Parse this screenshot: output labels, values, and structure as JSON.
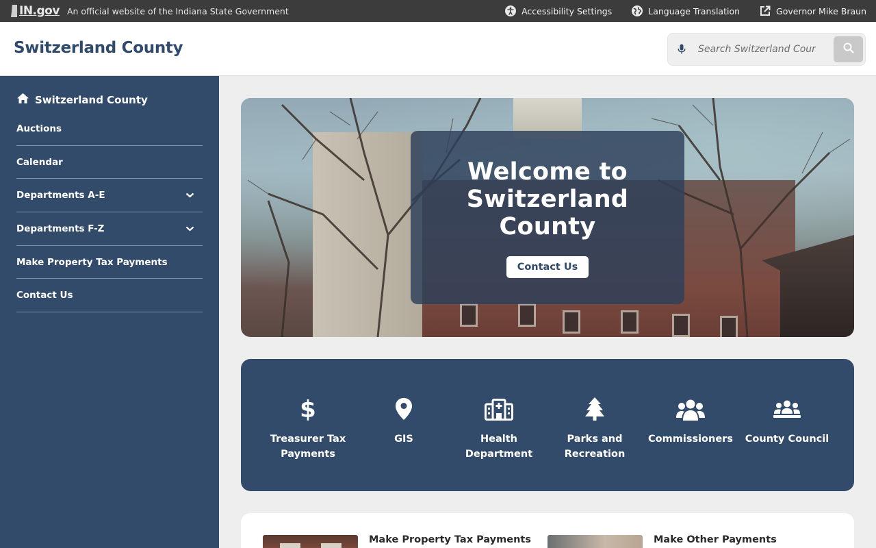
{
  "statebar": {
    "logo_text": "IN.gov",
    "official_text": "An official website of the Indiana State Government",
    "links": [
      {
        "label": "Accessibility Settings",
        "icon": "accessibility-icon"
      },
      {
        "label": "Language Translation",
        "icon": "globe-icon"
      },
      {
        "label": "Governor Mike Braun",
        "icon": "external-link-icon"
      }
    ]
  },
  "header": {
    "title": "Switzerland County",
    "search": {
      "placeholder": "Search Switzerland County",
      "value": ""
    }
  },
  "sidebar": {
    "home_label": "Switzerland County",
    "items": [
      {
        "label": "Auctions",
        "expandable": false
      },
      {
        "label": "Calendar",
        "expandable": false
      },
      {
        "label": "Departments A-E",
        "expandable": true
      },
      {
        "label": "Departments F-Z",
        "expandable": true
      },
      {
        "label": "Make Property Tax Payments",
        "expandable": false
      },
      {
        "label": "Contact Us",
        "expandable": false
      }
    ]
  },
  "hero": {
    "title": "Welcome to Switzerland County",
    "button_label": "Contact Us"
  },
  "quick_links": [
    {
      "label": "Treasurer Tax Payments",
      "icon": "dollar-icon"
    },
    {
      "label": "GIS",
      "icon": "map-pin-icon"
    },
    {
      "label": "Health Department",
      "icon": "hospital-icon"
    },
    {
      "label": "Parks and Recreation",
      "icon": "tree-icon"
    },
    {
      "label": "Commissioners",
      "icon": "users-icon"
    },
    {
      "label": "County Council",
      "icon": "council-icon"
    }
  ],
  "cards": [
    {
      "title": "Make Property Tax Payments"
    },
    {
      "title": "Make Other Payments"
    }
  ],
  "colors": {
    "navy": "#324b6b",
    "statebar": "#3c3c3c",
    "title": "#2f4a6b"
  }
}
